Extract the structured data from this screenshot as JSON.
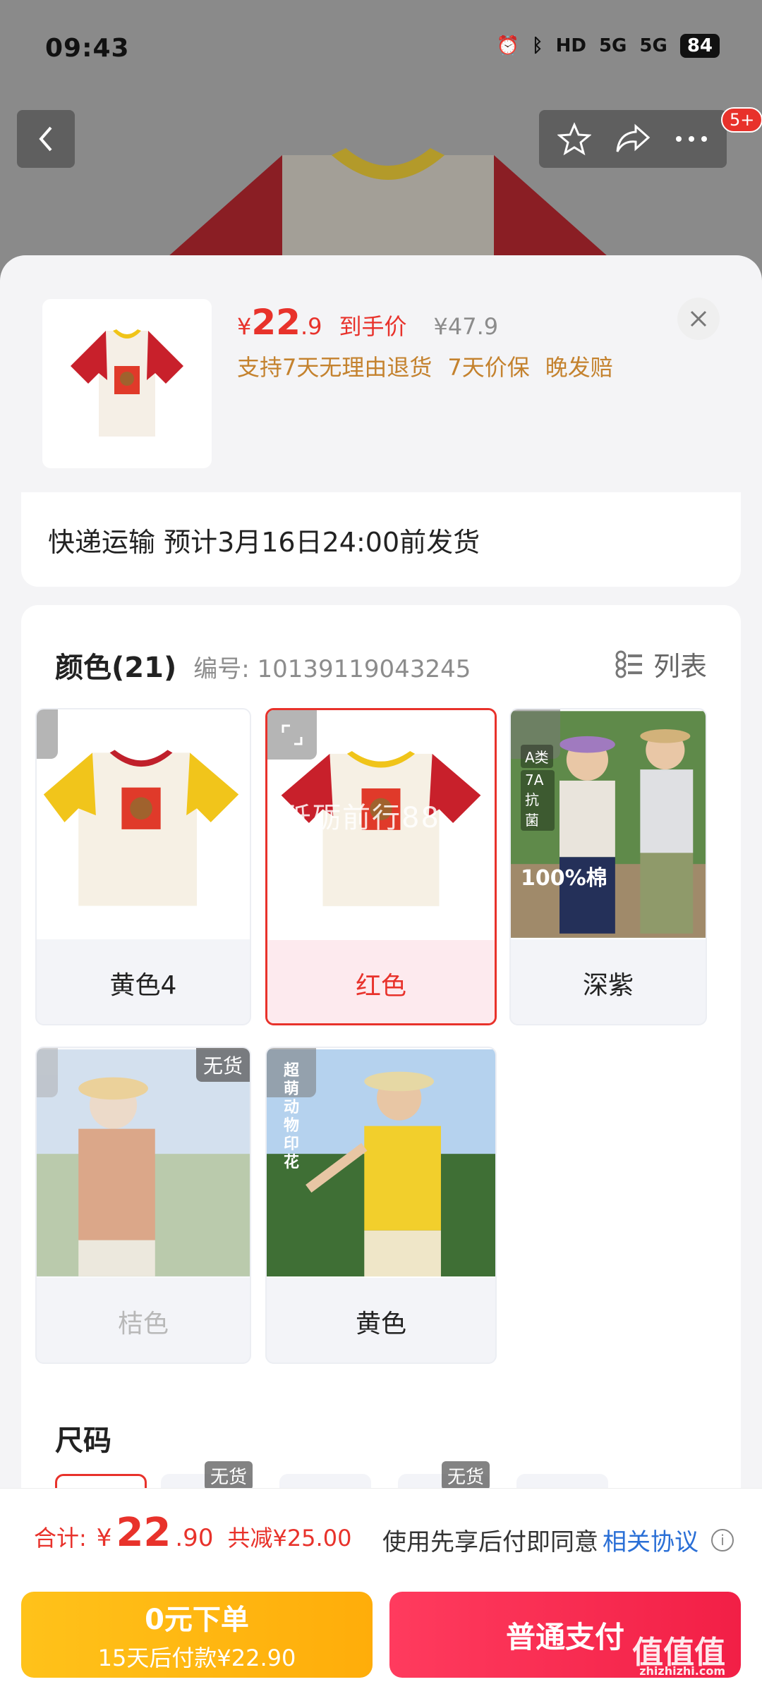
{
  "status": {
    "time": "09:43",
    "battery": "84",
    "network1": "5G",
    "network2": "5G",
    "hd": "HD"
  },
  "nav": {
    "badge": "5+"
  },
  "product": {
    "price_currency": "¥",
    "price_main": "22",
    "price_decimal": ".9",
    "price_label": "到手价",
    "original_price": "¥47.9",
    "services": [
      "支持7天无理由退货",
      "7天价保",
      "晚发赔"
    ]
  },
  "delivery": {
    "text": "快递运输 预计3月16日24:00前发货"
  },
  "colors": {
    "title": "颜色(21)",
    "code": "编号: 10139119043245",
    "list_label": "列表",
    "options": [
      {
        "label": "黄色4",
        "state": "normal"
      },
      {
        "label": "红色",
        "state": "selected",
        "watermark": "砥砺前行88"
      },
      {
        "label": "深紫",
        "state": "normal",
        "photo_text": "100%棉",
        "tag1": "A类",
        "tag2": "7A抗菌"
      },
      {
        "label": "桔色",
        "state": "disabled",
        "badge": "无货"
      },
      {
        "label": "黄色",
        "state": "normal",
        "photo_text": "超萌动物印花"
      }
    ]
  },
  "size": {
    "title": "尺码",
    "chip_badges": [
      "无货",
      "无货"
    ]
  },
  "bottom": {
    "total_label": "合计:",
    "total_currency": "¥",
    "total_main": "22",
    "total_decimal": ".90",
    "total_discount": "共减¥25.00",
    "agree_text": "使用先享后付即同意",
    "agree_link": "相关协议",
    "bnpl_title": "0元下单",
    "bnpl_sub": "15天后付款¥22.90",
    "pay_label": "普通支付",
    "corner_mark": "值值值",
    "corner_sub": "zhizhizhi.com"
  }
}
